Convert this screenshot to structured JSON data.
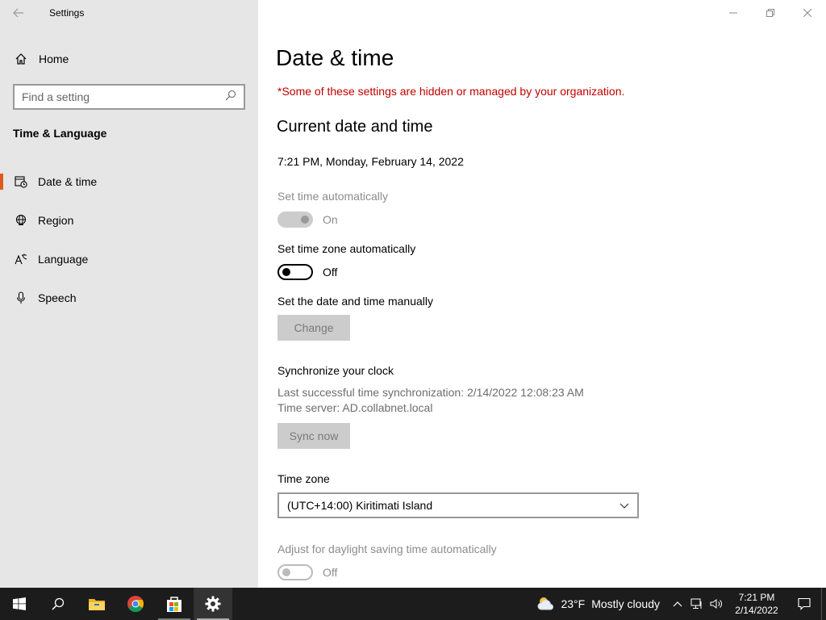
{
  "window": {
    "title": "Settings",
    "icons": {
      "back": "back-arrow-icon",
      "minimize": "minimize-icon",
      "restore": "restore-icon",
      "close": "close-icon"
    }
  },
  "sidebar": {
    "home_label": "Home",
    "search_placeholder": "Find a setting",
    "section_title": "Time & Language",
    "items": [
      {
        "label": "Date & time",
        "icon": "date-time-icon",
        "active": true
      },
      {
        "label": "Region",
        "icon": "globe-icon",
        "active": false
      },
      {
        "label": "Language",
        "icon": "language-icon",
        "active": false
      },
      {
        "label": "Speech",
        "icon": "microphone-icon",
        "active": false
      }
    ]
  },
  "main": {
    "title": "Date & time",
    "managed_warning": "*Some of these settings are hidden or managed by your organization.",
    "current_heading": "Current date and time",
    "current_datetime": "7:21 PM, Monday, February 14, 2022",
    "set_time_auto": {
      "label": "Set time automatically",
      "state": "On",
      "enabled": false
    },
    "set_timezone_auto": {
      "label": "Set time zone automatically",
      "state": "Off",
      "enabled": true
    },
    "manual": {
      "label": "Set the date and time manually",
      "button": "Change"
    },
    "sync": {
      "heading": "Synchronize your clock",
      "last_sync": "Last successful time synchronization: 2/14/2022 12:08:23 AM",
      "server": "Time server: AD.collabnet.local",
      "button": "Sync now"
    },
    "timezone": {
      "label": "Time zone",
      "value": "(UTC+14:00) Kiritimati Island"
    },
    "daylight": {
      "label": "Adjust for daylight saving time automatically",
      "state": "Off",
      "enabled": false
    }
  },
  "taskbar": {
    "apps": [
      "windows-start-icon",
      "search-icon",
      "file-explorer-icon",
      "chrome-icon",
      "store-icon",
      "settings-gear-icon"
    ],
    "weather_temp": "23°F",
    "weather_desc": "Mostly cloudy",
    "time": "7:21 PM",
    "date": "2/14/2022"
  },
  "colors": {
    "accent": "#e05a1d",
    "warning": "#c00000",
    "sidebar_bg": "#e6e6e6",
    "taskbar_bg": "#1c1c1c"
  }
}
